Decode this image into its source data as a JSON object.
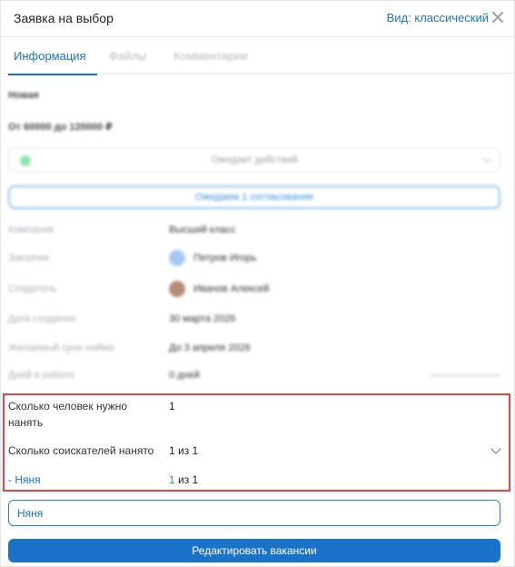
{
  "header": {
    "title": "Заявка на выбор",
    "view_label": "Вид: классический"
  },
  "tabs": [
    {
      "label": "Информация",
      "active": true
    },
    {
      "label": "Файлы",
      "active": false
    },
    {
      "label": "Комментарии",
      "active": false
    }
  ],
  "summary": {
    "status_name": "Новая",
    "salary": "От 60000 до 120000 ₽"
  },
  "status_select": {
    "value": "Ожидает действий"
  },
  "approval_button": "Ожидаем 1 согласование",
  "details": {
    "company_label": "Компания",
    "company_value": "Высший класс",
    "customer_label": "Заказчик",
    "customer_value": "Петров Игорь",
    "creator_label": "Создатель",
    "creator_value": "Иванов Алексей",
    "created_label": "Дата создания",
    "created_value": "30 марта 2026",
    "deadline_label": "Желаемый срок найма",
    "deadline_value": "До 3 апреля 2026",
    "days_label": "Дней в работе",
    "days_value": "0 дней"
  },
  "hiring": {
    "need_label": "Сколько человек нужно нанять",
    "need_value": "1",
    "hired_label": "Сколько соискателей нанято",
    "hired_value": "1 из 1",
    "position_link": "- Няня",
    "position_hired": "1",
    "position_total": " из 1"
  },
  "vacancy_input": {
    "value": "Няня"
  },
  "edit_button": "Редактировать вакансии",
  "colors": {
    "accent": "#1a73c8",
    "highlight_border": "#e04848",
    "success": "#33a852"
  }
}
